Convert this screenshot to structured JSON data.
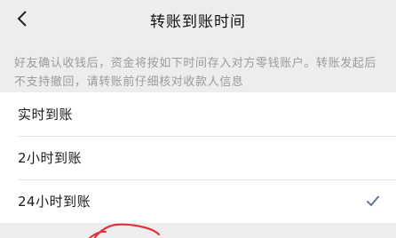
{
  "header": {
    "title": "转账到账时间",
    "back_icon": "chevron-left-icon"
  },
  "notice": {
    "text": "好友确认收钱后，资金将按如下时间存入对方零钱账户。转账发起后不支持撤回，请转账前仔细核对收款人信息"
  },
  "options": [
    {
      "label": "实时到账",
      "selected": false
    },
    {
      "label": "2小时到账",
      "selected": false
    },
    {
      "label": "24小时到账",
      "selected": true
    }
  ],
  "colors": {
    "background": "#ededed",
    "check": "#576b95",
    "annotation": "#e0303a"
  }
}
